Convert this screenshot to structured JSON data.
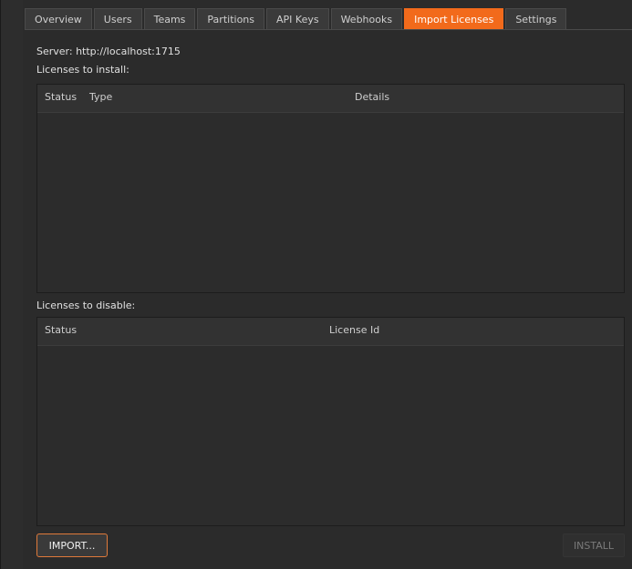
{
  "tabs": [
    {
      "label": "Overview",
      "active": false
    },
    {
      "label": "Users",
      "active": false
    },
    {
      "label": "Teams",
      "active": false
    },
    {
      "label": "Partitions",
      "active": false
    },
    {
      "label": "API Keys",
      "active": false
    },
    {
      "label": "Webhooks",
      "active": false
    },
    {
      "label": "Import Licenses",
      "active": true
    },
    {
      "label": "Settings",
      "active": false
    }
  ],
  "server": {
    "text": "Server:  http://localhost:1715"
  },
  "install_section": {
    "label": "Licenses to install:",
    "columns": [
      "Status",
      "Type",
      "Details"
    ],
    "rows": []
  },
  "disable_section": {
    "label": "Licenses to disable:",
    "columns": [
      "Status",
      "License Id"
    ],
    "rows": []
  },
  "buttons": {
    "import_label": "IMPORT...",
    "install_label": "INSTALL"
  },
  "colors": {
    "accent": "#f26a1b",
    "background": "#2b2b2b",
    "table_bg": "#2c2c2c"
  }
}
